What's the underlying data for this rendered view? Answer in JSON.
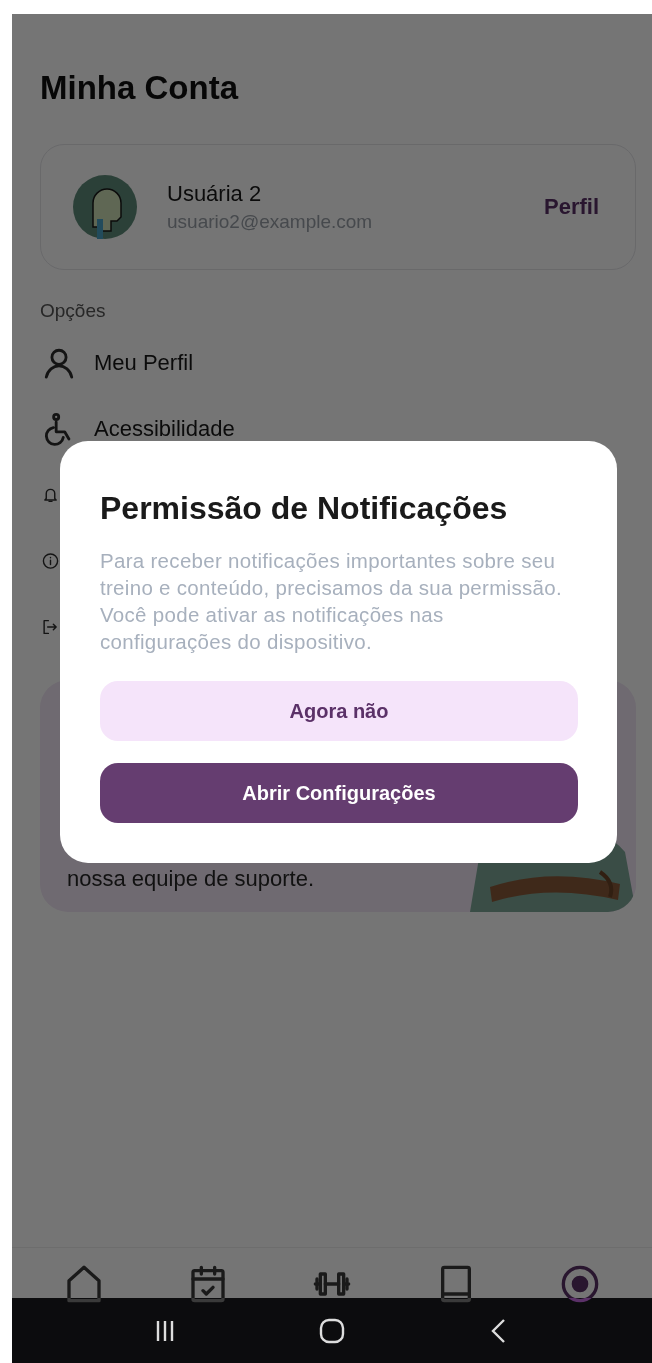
{
  "screen": {
    "title": "Minha Conta",
    "account": {
      "name": "Usuária 2",
      "email": "usuario2@example.com",
      "action": "Perfil"
    },
    "options_heading": "Opções",
    "options": [
      {
        "kind": "person",
        "label": "Meu Perfil"
      },
      {
        "kind": "accessibility",
        "label": "Acessibilidade"
      },
      {
        "kind": "bell"
      },
      {
        "kind": "info"
      },
      {
        "kind": "logout"
      }
    ],
    "support_card": {
      "text": "nossa equipe de suporte."
    },
    "tabs": [
      {
        "kind": "home",
        "selected": false
      },
      {
        "kind": "calendar",
        "selected": false
      },
      {
        "kind": "dumbbell",
        "selected": false
      },
      {
        "kind": "book",
        "selected": false
      },
      {
        "kind": "account",
        "selected": true
      }
    ]
  },
  "dialog": {
    "title": "Permissão de Notificações",
    "message": "Para receber notificações importantes sobre seu treino e conteúdo, precisamos da sua permissão. Você pode ativar as notificações nas configurações do dispositivo.",
    "buttons": [
      {
        "kind": "secondary",
        "label": "Agora não"
      },
      {
        "kind": "primary",
        "label": "Abrir Configurações"
      }
    ]
  }
}
